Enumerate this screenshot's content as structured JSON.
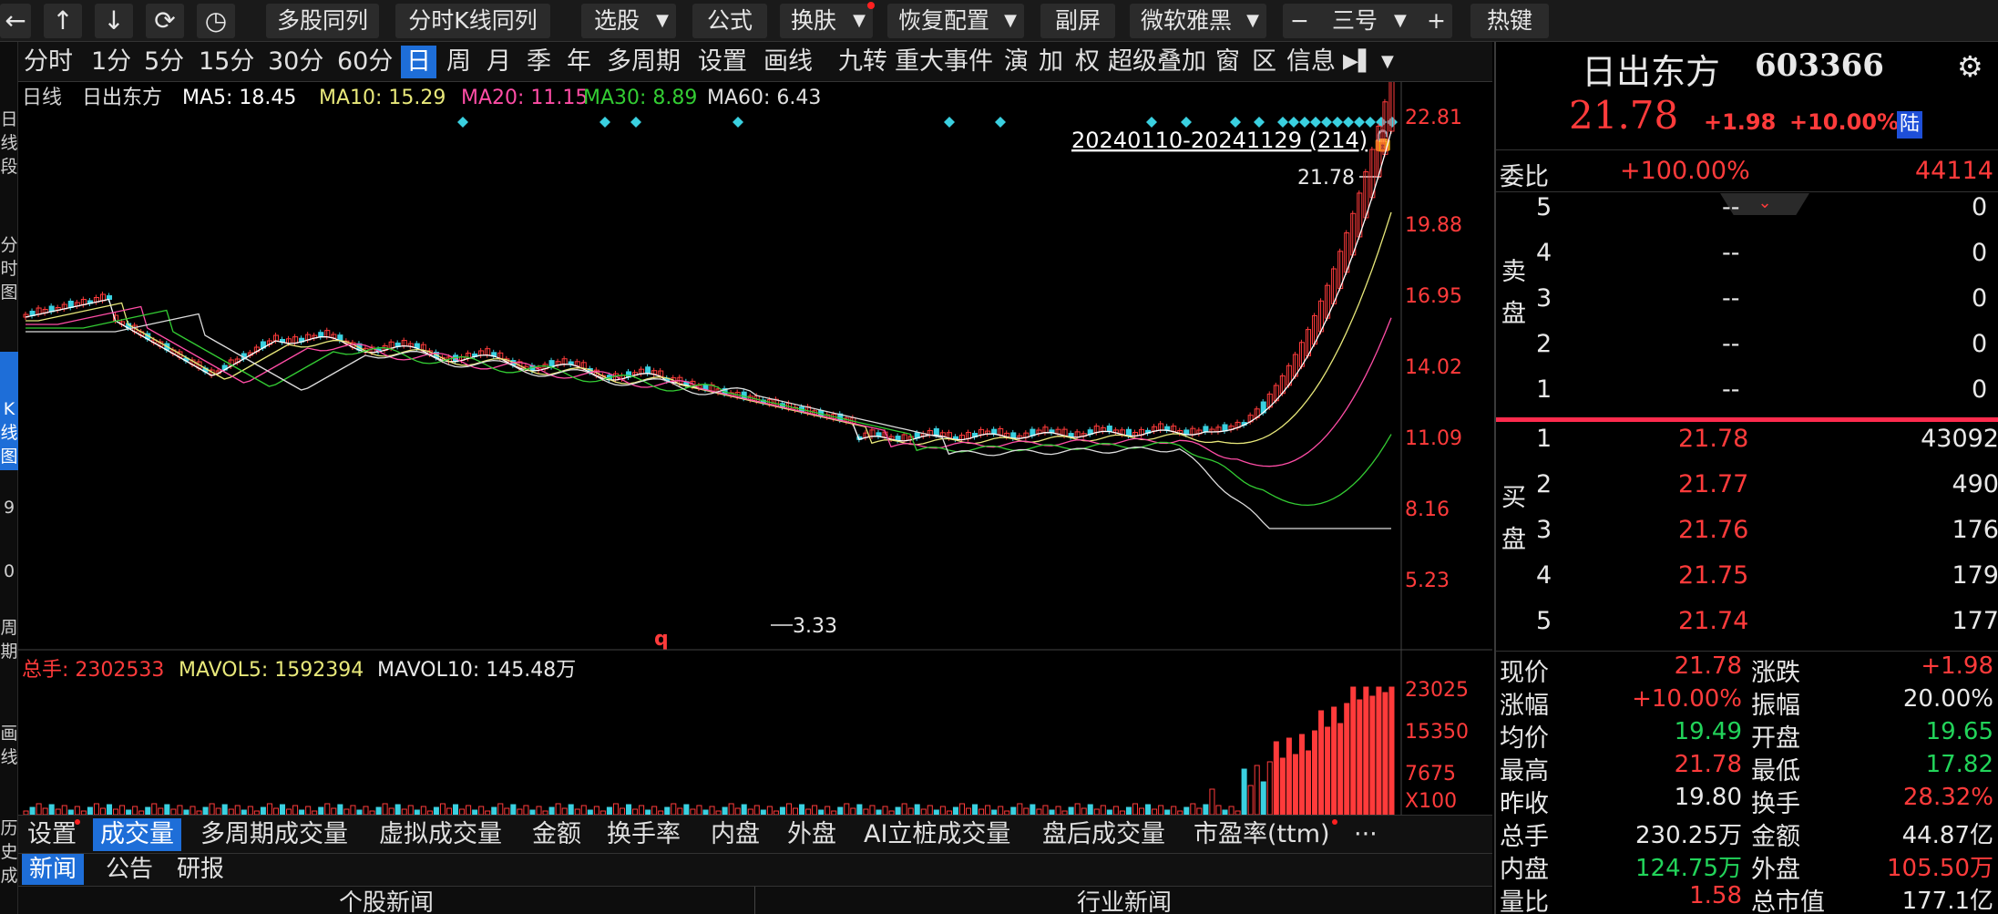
{
  "toolbar": {
    "back_label": "←",
    "up_label": "↑",
    "down_label": "↓",
    "refresh_label": "⟳",
    "history_label": "◷",
    "buttons": [
      "多股同列",
      "分时K线同列",
      "选股",
      "公式",
      "换肤",
      "恢复配置",
      "副屏",
      "微软雅黑",
      "三号",
      "热键"
    ],
    "minus": "−",
    "plus": "+"
  },
  "left_strip": [
    "日\n线\n段",
    "分\n时\n图",
    "K\n线\n图",
    "9",
    "0",
    "周\n期",
    "画\n线",
    "历\n史\n成"
  ],
  "period_bar": {
    "items": [
      "分时",
      "1分",
      "5分",
      "15分",
      "30分",
      "60分",
      "日",
      "周",
      "月",
      "季",
      "年",
      "多周期",
      "设置",
      "画线",
      "九转",
      "重大事件",
      "演",
      "加",
      "权",
      "超级叠加",
      "窗",
      "区",
      "信息"
    ],
    "active_index": 6
  },
  "kline": {
    "legend_prefix": "日线",
    "stock_name": "日出东方",
    "ma5": "MA5: 18.45",
    "ma10": "MA10: 15.29",
    "ma20": "MA20: 11.15",
    "ma30": "MA30: 8.89",
    "ma60": "MA60: 6.43",
    "range_label": "20240110-20241129 (214)",
    "max_label": "21.78",
    "min_label": "3.33",
    "marker_q": "q",
    "y_ticks": [
      "22.81",
      "19.88",
      "16.95",
      "14.02",
      "11.09",
      "8.16",
      "5.23"
    ],
    "colors": {
      "up": "#ff3b3b",
      "down": "#3ad0e0",
      "ma5": "#ffffff",
      "ma10": "#e8e87a",
      "ma20": "#ff4da6",
      "ma30": "#33cc33",
      "ma60": "#dddddd"
    }
  },
  "volume": {
    "label_total": "总手: 2302533",
    "label_mavol5": "MAVOL5: 1592394",
    "label_mavol10": "MAVOL10: 145.48万",
    "y_ticks": [
      "23025",
      "15350",
      "7675",
      "X100"
    ]
  },
  "sub_tabs": {
    "items": [
      "设置",
      "成交量",
      "多周期成交量",
      "虚拟成交量",
      "金额",
      "换手率",
      "内盘",
      "外盘",
      "AI立桩成交量",
      "盘后成交量",
      "市盈率(ttm)",
      "···"
    ],
    "active_index": 1
  },
  "news_tabs": {
    "items": [
      "新闻",
      "公告",
      "研报"
    ],
    "active_index": 0
  },
  "news_heads": [
    "个股新闻",
    "行业新闻"
  ],
  "quote": {
    "name": "日出东方",
    "code": "603366",
    "price": "21.78",
    "change": "+1.98",
    "pct": "+10.00%",
    "tag": "陆",
    "weibi_label": "委比",
    "weibi_value": "+100.00%",
    "weibi_count": "44114",
    "sell_label": "卖\n盘",
    "buy_label": "买\n盘",
    "sell": [
      [
        "5",
        "--",
        "0"
      ],
      [
        "4",
        "--",
        "0"
      ],
      [
        "3",
        "--",
        "0"
      ],
      [
        "2",
        "--",
        "0"
      ],
      [
        "1",
        "--",
        "0"
      ]
    ],
    "buy": [
      [
        "1",
        "21.78",
        "43092"
      ],
      [
        "2",
        "21.77",
        "490"
      ],
      [
        "3",
        "21.76",
        "176"
      ],
      [
        "4",
        "21.75",
        "179"
      ],
      [
        "5",
        "21.74",
        "177"
      ]
    ],
    "stats": [
      [
        "现价",
        "21.78",
        "涨跌",
        "+1.98"
      ],
      [
        "涨幅",
        "+10.00%",
        "振幅",
        "20.00%"
      ],
      [
        "均价",
        "19.49",
        "开盘",
        "19.65"
      ],
      [
        "最高",
        "21.78",
        "最低",
        "17.82"
      ],
      [
        "昨收",
        "19.80",
        "换手",
        "28.32%"
      ],
      [
        "总手",
        "230.25万",
        "金额",
        "44.87亿"
      ],
      [
        "内盘",
        "124.75万",
        "外盘",
        "105.50万"
      ],
      [
        "量比",
        "1.58",
        "总市值",
        "177.1亿"
      ]
    ]
  }
}
